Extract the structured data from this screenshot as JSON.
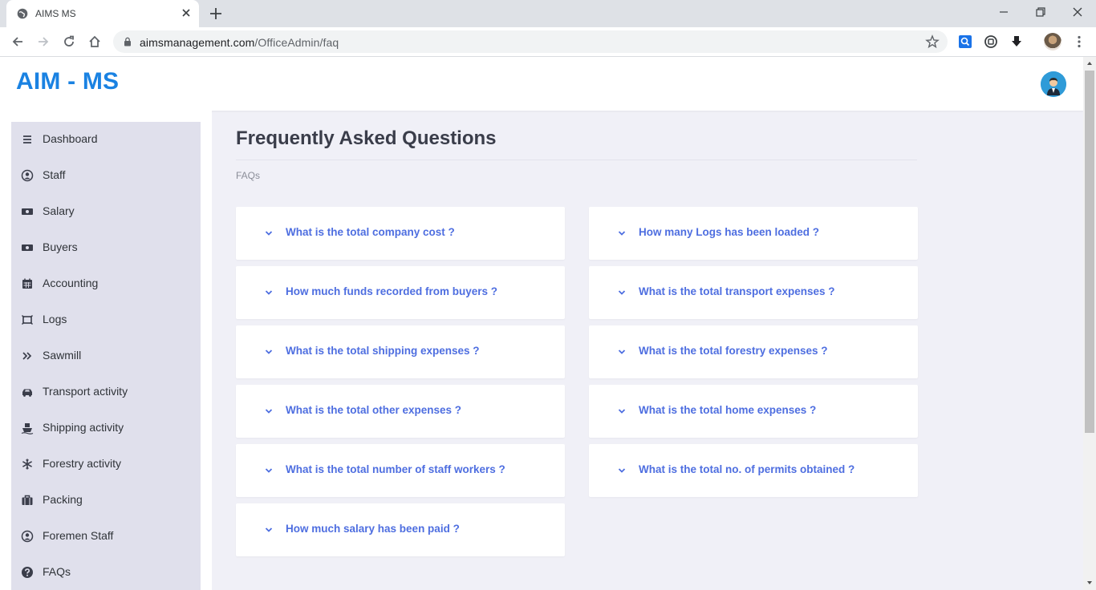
{
  "browser": {
    "tab_title": "AIMS MS",
    "url_host": "aimsmanagement.com",
    "url_path": "/OfficeAdmin/faq"
  },
  "app": {
    "brand": "AIM - MS"
  },
  "sidebar": {
    "items": [
      {
        "label": "Dashboard",
        "icon": "menu-icon"
      },
      {
        "label": "Staff",
        "icon": "user-circle-icon"
      },
      {
        "label": "Salary",
        "icon": "money-icon"
      },
      {
        "label": "Buyers",
        "icon": "money-icon"
      },
      {
        "label": "Accounting",
        "icon": "calendar-icon"
      },
      {
        "label": "Logs",
        "icon": "logs-icon"
      },
      {
        "label": "Sawmill",
        "icon": "double-chevron-icon"
      },
      {
        "label": "Transport activity",
        "icon": "car-icon"
      },
      {
        "label": "Shipping activity",
        "icon": "ship-icon"
      },
      {
        "label": "Forestry activity",
        "icon": "snowflake-icon"
      },
      {
        "label": "Packing",
        "icon": "briefcase-icon"
      },
      {
        "label": "Foremen Staff",
        "icon": "user-circle-icon"
      },
      {
        "label": "FAQs",
        "icon": "question-circle-icon"
      }
    ]
  },
  "main": {
    "title": "Frequently Asked Questions",
    "breadcrumb": "FAQs",
    "faqs_left": [
      "What is the total company cost ?",
      "How much funds recorded from buyers ?",
      "What is the total shipping expenses ?",
      "What is the total other expenses ?",
      "What is the total number of staff workers ?",
      "How much salary has been paid ?"
    ],
    "faqs_right": [
      "How many Logs has been loaded ?",
      "What is the total transport expenses ?",
      "What is the total forestry expenses ?",
      "What is the total home expenses ?",
      "What is the total no. of permits obtained ?"
    ]
  },
  "colors": {
    "brand": "#1a82e2",
    "faq_link": "#4e6ee0",
    "sidebar_bg": "#e0e0ec",
    "page_bg": "#f0f0f7"
  }
}
